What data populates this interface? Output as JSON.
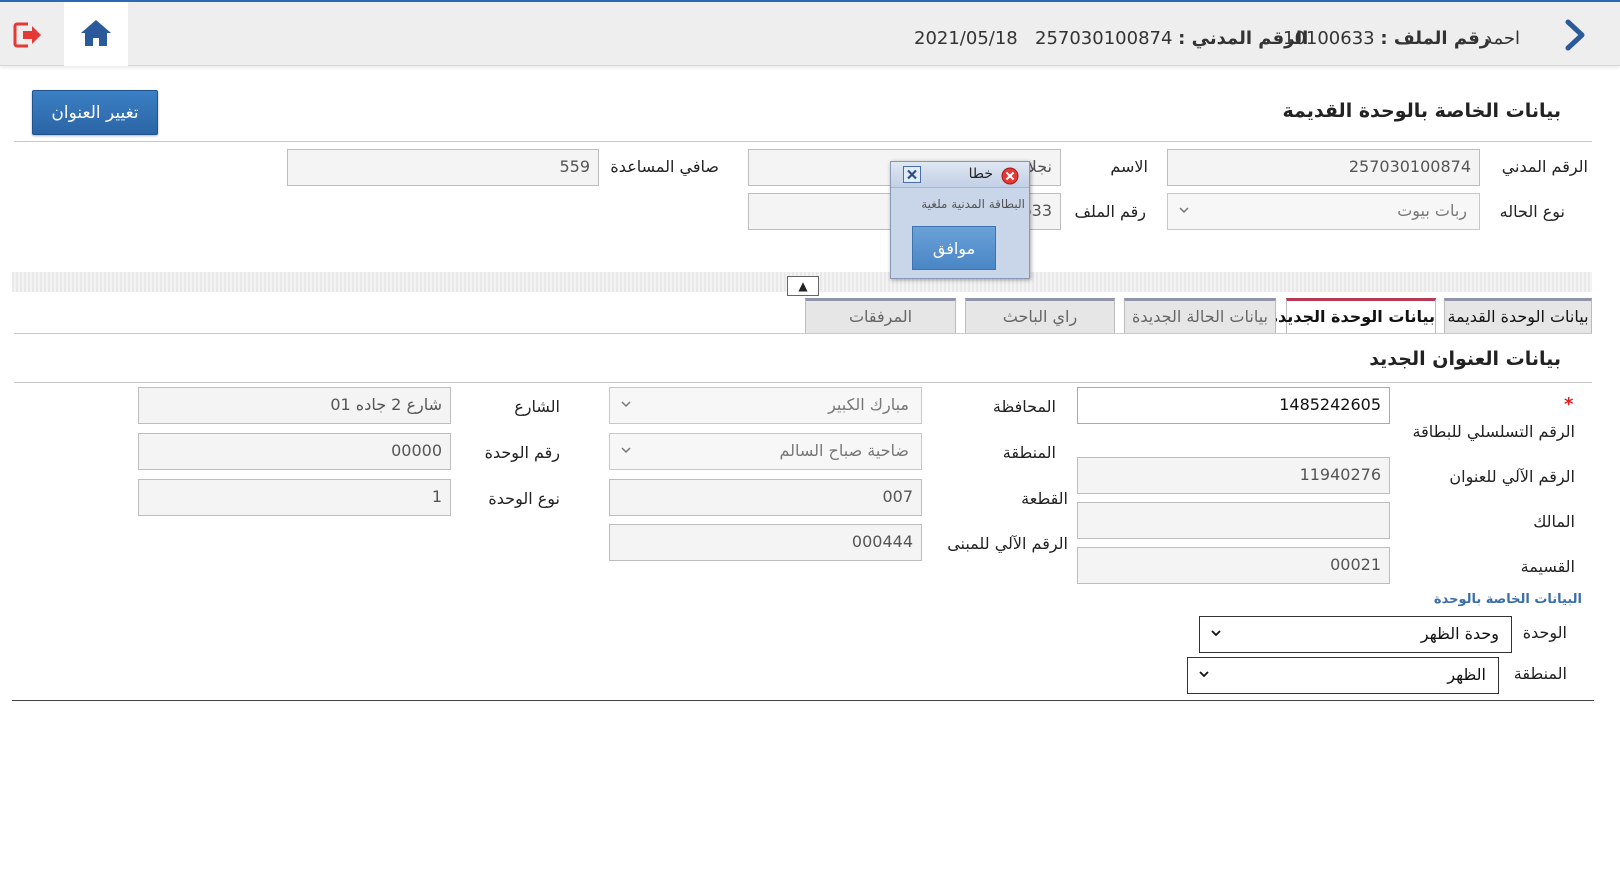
{
  "header": {
    "user_name": "احمد",
    "file_no_label": "رقم الملف :",
    "file_no_value": "10100633",
    "civil_id_label": "الرقم المدني :",
    "civil_id_value": "257030100874",
    "date": "2021/05/18"
  },
  "old_unit": {
    "title": "بيانات الخاصة بالوحدة القديمة",
    "change_address_button": "تغيير العنوان",
    "civil_id_label": "الرقم المدني",
    "civil_id_value": "257030100874",
    "name_label": "الاسم",
    "name_value": "نجلاء",
    "net_aid_label": "صافي المساعدة",
    "net_aid_value": "559",
    "case_type_label": "نوع الحاله",
    "case_type_value": "ربات بيوت",
    "file_no_label": "رقم الملف",
    "file_no_value": "633"
  },
  "tabs": [
    {
      "label": "بيانات الوحدة القديمة"
    },
    {
      "label": "بيانات الوحدة الجديدة"
    },
    {
      "label": "بيانات الحالة الجديدة"
    },
    {
      "label": "راي الباحث"
    },
    {
      "label": "المرفقات"
    }
  ],
  "collapse_toggle": "▲",
  "new_address": {
    "title": "بيانات العنوان الجديد",
    "required_mark": "*",
    "card_serial_label": "الرقم التسلسلي للبطاقة",
    "card_serial_value": "1485242605",
    "auto_addr_label": "الرقم الآلي للعنوان",
    "auto_addr_value": "11940276",
    "owner_label": "المالك",
    "owner_value": "",
    "plot_label": "القسيمة",
    "plot_value": "00021",
    "governorate_label": "المحافظة",
    "governorate_value": "مبارك الكبير",
    "area_label": "المنطقة",
    "area_value": "ضاحية صباح السالم",
    "block_label": "القطعة",
    "block_value": "007",
    "building_no_label": "الرقم الآلي للمبنى",
    "building_no_value": "000444",
    "street_label": "الشارع",
    "street_value": "شارع 2 جاده 01",
    "unit_no_label": "رقم الوحدة",
    "unit_no_value": "00000",
    "unit_type_label": "نوع الوحدة",
    "unit_type_value": "1",
    "unit_data_subhead": "البيانات الخاصة بالوحدة",
    "unit_label": "الوحدة",
    "unit_value": "وحدة الظهر",
    "region_label": "المنطقة",
    "region_value": "الظهر"
  },
  "dialog": {
    "title": "خطا",
    "message": "البطاقة المدنية ملغية",
    "ok_button": "موافق"
  },
  "colors": {
    "accent": "#2d69b3",
    "active_tab": "#b43a56",
    "error": "#e53935"
  }
}
